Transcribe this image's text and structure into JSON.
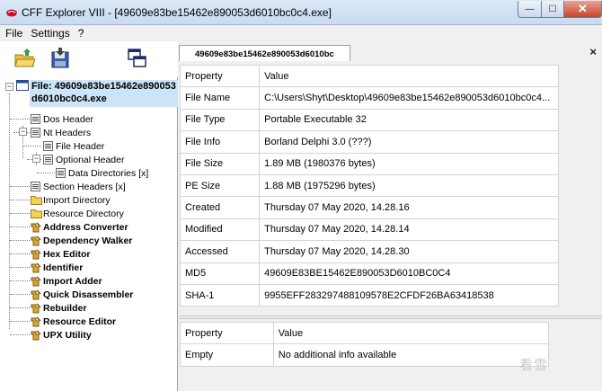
{
  "window": {
    "title": "CFF Explorer VIII - [49609e83be15462e890053d6010bc0c4.exe]",
    "minimize_glyph": "—",
    "maximize_glyph": "☐",
    "close_glyph": "✕"
  },
  "menu": [
    "File",
    "Settings",
    "?"
  ],
  "toolbar": {
    "buttons": [
      {
        "name": "open-file-icon"
      },
      {
        "name": "save-file-icon"
      },
      {
        "name": "windows-icon"
      }
    ]
  },
  "tree": {
    "root": {
      "line1": "File: 49609e83be15462e890053",
      "line2": "d6010bc0c4.exe"
    },
    "items": [
      {
        "label": "Dos Header"
      },
      {
        "label": "Nt Headers"
      },
      {
        "label": "File Header"
      },
      {
        "label": "Optional Header"
      },
      {
        "label": "Data Directories [x]"
      },
      {
        "label": "Section Headers [x]"
      },
      {
        "label": "Import Directory"
      },
      {
        "label": "Resource Directory"
      },
      {
        "label": "Address Converter"
      },
      {
        "label": "Dependency Walker"
      },
      {
        "label": "Hex Editor"
      },
      {
        "label": "Identifier"
      },
      {
        "label": "Import Adder"
      },
      {
        "label": "Quick Disassembler"
      },
      {
        "label": "Rebuilder"
      },
      {
        "label": "Resource Editor"
      },
      {
        "label": "UPX Utility"
      }
    ]
  },
  "tab": {
    "label": "49609e83be15462e890053d6010bc",
    "close": "×"
  },
  "props": {
    "headers": [
      "Property",
      "Value"
    ],
    "rows": [
      [
        "File Name",
        "C:\\Users\\Shyt\\Desktop\\49609e83be15462e890053d6010bc0c4..."
      ],
      [
        "File Type",
        "Portable Executable 32"
      ],
      [
        "File Info",
        "Borland Delphi 3.0 (???)"
      ],
      [
        "File Size",
        "1.89 MB (1980376 bytes)"
      ],
      [
        "PE Size",
        "1.88 MB (1975296 bytes)"
      ],
      [
        "Created",
        "Thursday 07 May 2020, 14.28.16"
      ],
      [
        "Modified",
        "Thursday 07 May 2020, 14.28.14"
      ],
      [
        "Accessed",
        "Thursday 07 May 2020, 14.28.30"
      ],
      [
        "MD5",
        "49609E83BE15462E890053D6010BC0C4"
      ],
      [
        "SHA-1",
        "9955EFF283297488109578E2CFDF26BA63418538"
      ]
    ]
  },
  "info": {
    "headers": [
      "Property",
      "Value"
    ],
    "rows": [
      [
        "Empty",
        "No additional info available"
      ]
    ]
  },
  "watermark": "看雪"
}
